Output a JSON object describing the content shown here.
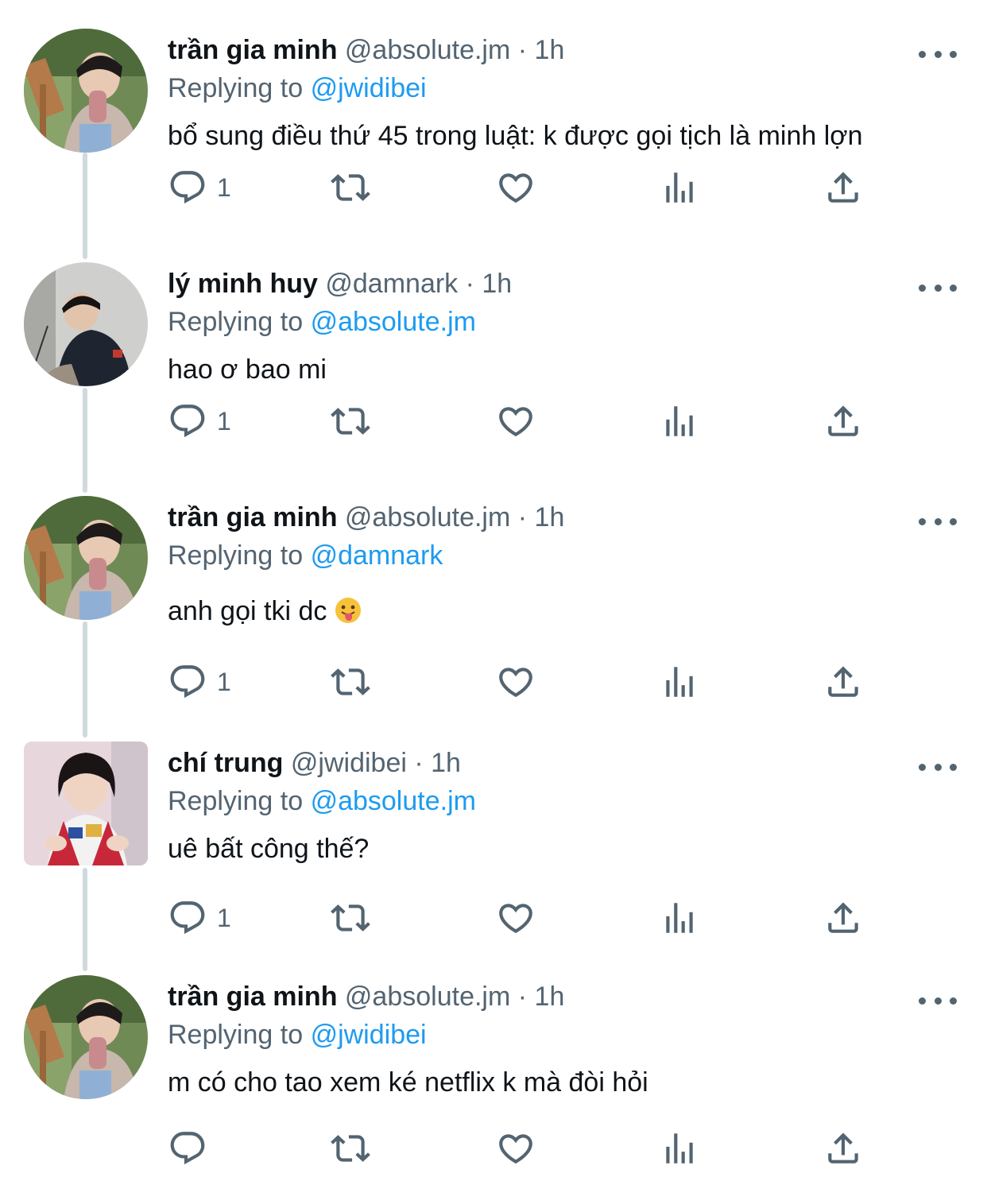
{
  "tweets": [
    {
      "name": "trần gia minh",
      "handle": "@absolute.jm",
      "time": "· 1h",
      "replying_prefix": "Replying to",
      "replying_to": "@jwidibei",
      "text": "bổ sung điều thứ 45 trong luật: k được gọi tịch là minh lợn",
      "reply_count": "1",
      "avatar": "minh-avatar"
    },
    {
      "name": "lý minh huy",
      "handle": "@damnark",
      "time": "· 1h",
      "replying_prefix": "Replying to",
      "replying_to": "@absolute.jm",
      "text": "hao ơ bao mi",
      "reply_count": "1",
      "avatar": "huy-avatar"
    },
    {
      "name": "trần gia minh",
      "handle": "@absolute.jm",
      "time": "· 1h",
      "replying_prefix": "Replying to",
      "replying_to": "@damnark",
      "text": "anh gọi tki dc",
      "emoji": "face-with-tongue-emoji",
      "reply_count": "1",
      "avatar": "minh-avatar"
    },
    {
      "name": "chí trung",
      "handle": "@jwidibei",
      "time": "· 1h",
      "replying_prefix": "Replying to",
      "replying_to": "@absolute.jm",
      "text": "uê bất công thế?",
      "reply_count": "1",
      "avatar": "trung-avatar"
    },
    {
      "name": "trần gia minh",
      "handle": "@absolute.jm",
      "time": "· 1h",
      "replying_prefix": "Replying to",
      "replying_to": "@jwidibei",
      "text": "m có cho tao xem ké netflix k mà đòi hỏi",
      "reply_count": "",
      "avatar": "minh-avatar"
    }
  ],
  "colors": {
    "text": "#0f1419",
    "secondary": "#536471",
    "link": "#1d9bf0",
    "thread_line": "#cfd9de"
  },
  "icons": [
    "reply-icon",
    "retweet-icon",
    "like-icon",
    "views-icon",
    "share-icon",
    "more-icon"
  ]
}
